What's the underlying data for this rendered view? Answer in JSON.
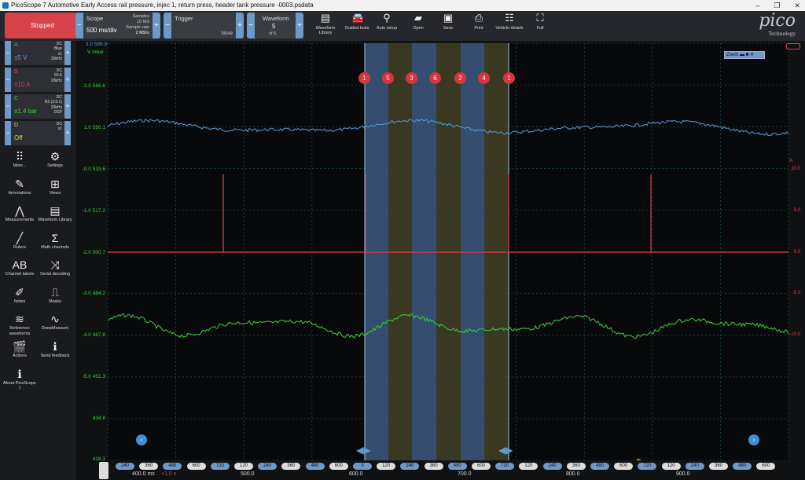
{
  "window": {
    "title": "PicoScope 7 Automotive Early Access rail pressure, injec 1, return press, header tank pressure -0003.psdata",
    "controls": [
      "–",
      "❐",
      "✕"
    ]
  },
  "toolbar": {
    "stop_label": "Stopped",
    "scope": {
      "title": "Scope",
      "timebase": "500 ms/div",
      "samples_label": "Samples",
      "samples_value": "10 MS",
      "rate_label": "Sample rate",
      "rate_value": "2 MS/s"
    },
    "trigger": {
      "title": "Trigger",
      "mode": "None"
    },
    "waveform": {
      "title": "Waveform",
      "current": "5",
      "of": "of 6"
    },
    "buttons": [
      {
        "name": "waveform-library",
        "icon": "library-icon",
        "label": "Waveform Library"
      },
      {
        "name": "guided-tests",
        "icon": "car-icon",
        "label": "Guided tests"
      },
      {
        "name": "auto-setup",
        "icon": "wand-icon",
        "label": "Auto setup"
      },
      {
        "name": "open",
        "icon": "folder-icon",
        "label": "Open"
      },
      {
        "name": "save",
        "icon": "save-icon",
        "label": "Save"
      },
      {
        "name": "print",
        "icon": "print-icon",
        "label": "Print"
      },
      {
        "name": "vehicle-details",
        "icon": "clipboard-icon",
        "label": "Vehicle details"
      },
      {
        "name": "full",
        "icon": "fullscreen-icon",
        "label": "Full"
      }
    ],
    "logo": "pico",
    "logo_sub": "Technology"
  },
  "channels": [
    {
      "name": "A",
      "range": "±5 V",
      "info": [
        "DC",
        "Blue",
        "x1",
        "20kHz"
      ],
      "color": "#5b9bd5"
    },
    {
      "name": "B",
      "range": "±10 A",
      "info": [
        "DC",
        "60 A",
        "20kHz"
      ],
      "color": "#e04050"
    },
    {
      "name": "C",
      "range": "±1.4 bar",
      "info": [
        "DC",
        "R2 (3.5:1)",
        "20kHz",
        "DSP"
      ],
      "color": "#3bd13b"
    },
    {
      "name": "D",
      "range": "Off",
      "info": [
        "DC",
        "x1"
      ],
      "color": "#e8d24a"
    }
  ],
  "side_buttons": [
    {
      "name": "more",
      "icon": "grid-icon",
      "glyph": "⠿",
      "label": "More..."
    },
    {
      "name": "settings",
      "icon": "gear-icon",
      "glyph": "⚙",
      "label": "Settings"
    },
    {
      "name": "annotations",
      "icon": "annotation-icon",
      "glyph": "✎",
      "label": "Annotations"
    },
    {
      "name": "views",
      "icon": "views-icon",
      "glyph": "⊞",
      "label": "Views"
    },
    {
      "name": "measurements",
      "icon": "measure-icon",
      "glyph": "⋀",
      "label": "Measurements"
    },
    {
      "name": "waveform-library",
      "icon": "library-icon",
      "glyph": "▤",
      "label": "Waveform Library"
    },
    {
      "name": "rulers",
      "icon": "ruler-icon",
      "glyph": "╱",
      "label": "Rulers"
    },
    {
      "name": "math-channels",
      "icon": "sigma-icon",
      "glyph": "Σ",
      "label": "Math channels"
    },
    {
      "name": "channel-labels",
      "icon": "abcd-icon",
      "glyph": "AB",
      "label": "Channel labels"
    },
    {
      "name": "serial-decoding",
      "icon": "serial-icon",
      "glyph": "⤨",
      "label": "Serial decoding"
    },
    {
      "name": "notes",
      "icon": "notes-icon",
      "glyph": "✐",
      "label": "Notes"
    },
    {
      "name": "masks",
      "icon": "mask-icon",
      "glyph": "⎍",
      "label": "Masks"
    },
    {
      "name": "reference-waveforms",
      "icon": "reference-icon",
      "glyph": "≋",
      "label": "Reference waveforms"
    },
    {
      "name": "deepmeasure",
      "icon": "deepmeasure-icon",
      "glyph": "∿",
      "label": "DeepMeasure"
    },
    {
      "name": "actions",
      "icon": "actions-icon",
      "glyph": "🎬",
      "label": "Actions"
    },
    {
      "name": "send-feedback",
      "icon": "feedback-icon",
      "glyph": "ℹ",
      "label": "Send feedback"
    },
    {
      "name": "about",
      "icon": "info-icon",
      "glyph": "ℹ",
      "label": "About PicoScope 7"
    }
  ],
  "plot": {
    "units_left": "V mbar",
    "units_right": "A",
    "left_ticks": [
      "3.0 599.9",
      "2.0 566.6",
      "1.0 550.1",
      "-0.0 533.6",
      "-1.0 517.2",
      "-2.0 500.7",
      "-3.0 484.2",
      "-4.0 467.8",
      "-5.0 451.3",
      "434.8",
      "418.3"
    ],
    "right_ticks": [
      "10.0",
      "5.0",
      "0.0",
      "-5.0",
      "-10.0"
    ],
    "markers": [
      "1",
      "5",
      "3",
      "6",
      "2",
      "4",
      "1"
    ],
    "zoom_label": "Zoom"
  },
  "timeline": {
    "segments": [
      "240",
      "360",
      "480",
      "600",
      "720",
      "120",
      "240",
      "360",
      "480",
      "600",
      "0",
      "120",
      "240",
      "360",
      "480",
      "600",
      "720",
      "120",
      "240",
      "360",
      "480",
      "600",
      "720",
      "120",
      "240",
      "360",
      "480",
      "600"
    ],
    "times": [
      "400.0 ms",
      "500.0",
      "600.0",
      "700.0",
      "800.0",
      "900.0"
    ],
    "offset": "+1.0 s"
  },
  "colors": {
    "channel_a": "#5b9bd5",
    "channel_b": "#e04050",
    "channel_c": "#3bd13b",
    "highlight_blue": "#5b86c4",
    "highlight_olive": "#6b6838"
  }
}
